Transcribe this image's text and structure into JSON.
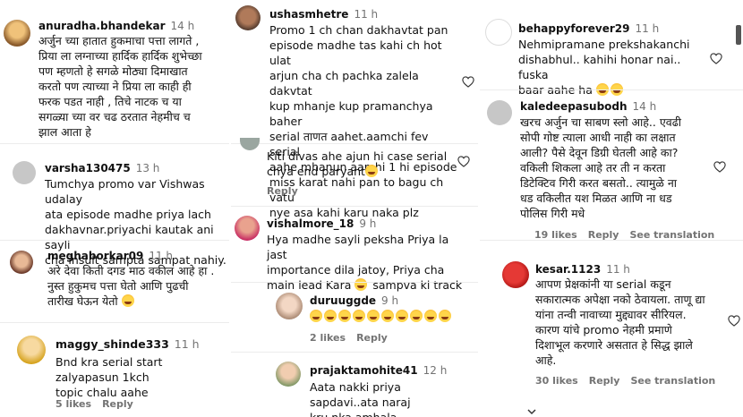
{
  "col1": {
    "c1": {
      "user": "anuradha.bhandekar",
      "time": "14 h",
      "lines": [
        "अर्जुन च्या हातात हुकमाचा पत्ता लागते ,",
        "प्रिया ला लग्नाच्या हार्दिक हार्दिक शुभेच्छा",
        "पण म्हणतो हे सगळे मोठ्या दिमाखात",
        "करतो पण त्याच्या ने प्रिया ला काही ही",
        "फरक पडत नाही , तिचे नाटक च या",
        "सगळ्या च्या वर चढ ठरतात नेहमीच च",
        "झाल आता हे"
      ]
    },
    "c2": {
      "user": "varsha130475",
      "time": "13 h",
      "lines": [
        "Tumchya promo var Vishwas udalay",
        "ata episode madhe priya lach",
        "dakhavnar.priyachi kautak ani sayli",
        "cha insult sampta sampat nahiy."
      ]
    },
    "c3": {
      "user": "meghaborkar09",
      "time": "11 h",
      "lines": [
        "अरे देवा किती दगड माठ वकील आहे हा .",
        "नुस्त हुकुमच पत्ता घेतो आणि पुढची",
        "तारीख घेऊन येतो"
      ]
    },
    "c4": {
      "user": "maggy_shinde333",
      "time": "11 h",
      "lines": [
        "Bnd kra serial start zalyapasun 1kch",
        "topic chalu aahe"
      ],
      "likes": "5 likes",
      "reply": "Reply"
    }
  },
  "col2": {
    "c1": {
      "user": "ushasmhetre",
      "time": "11 h",
      "lines": [
        "Promo 1 ch chan dakhavtat pan",
        "episode madhe tas kahi ch hot ulat",
        "arjun cha ch pachka zalela dakvtat",
        "kup mhanje kup pramanchya baher",
        "serial ताणत aahet.aamchi fev serial",
        "aahe mhanun aamhi 1 hi episode",
        "miss karat nahi pan to bagu ch vatu",
        "nye asa kahi karu naka plz"
      ]
    },
    "c2": {
      "lines": [
        "Kiti divas ahe ajun hi case serial",
        "chya end paryant"
      ],
      "reply": "Reply"
    },
    "c3": {
      "user": "vishalmore_18",
      "time": "9 h",
      "lines": [
        "Hya madhe sayli peksha Priya la jast",
        "importance dila jatoy, Priya cha",
        "main lead Kara",
        "sampva ki track"
      ]
    },
    "c4": {
      "user": "duruuggde",
      "time": "9 h",
      "likes": "2 likes",
      "reply": "Reply"
    },
    "c5": {
      "user": "prajaktamohite41",
      "time": "12 h",
      "lines": [
        "Aata nakki priya sapdavi..ata naraj",
        "kru nka amhala"
      ]
    }
  },
  "col3": {
    "c1": {
      "user": "behappyforever29",
      "time": "11 h",
      "lines": [
        "Nehmipramane prekshakanchi",
        "dishabhul.. kahihi honar nai.. fuska",
        "baar aahe ha"
      ]
    },
    "c2": {
      "user": "kaledeepasubodh",
      "time": "14 h",
      "lines": [
        "खरच अर्जुन चा साबण स्लो आहे.. एवढी",
        "सोपी गोष्ट त्याला आधी नाही का लक्षात",
        "आली? पैसे देवून डिग्री घेतली आहे का?",
        "वकिली शिकला आहे तर ती न करता",
        "डिटेक्टिव गिरी करत बसतो.. त्यामुळे ना",
        "धड वकिलीत यश मिळत आणि ना धड",
        "पोलिस गिरी मधे"
      ],
      "likes": "19 likes",
      "reply": "Reply",
      "see": "See translation"
    },
    "c3": {
      "user": "kesar.1123",
      "time": "11 h",
      "lines": [
        "आपण प्रेक्षकांनी या serial कडून",
        "सकारात्मक अपेक्षा नको ठेवायला. ताणू द्या",
        "यांना तन्वी नावाच्या मुद्द्यावर सीरियल.",
        "कारण यांचे promo नेहमी प्रमाणे",
        "दिशाभूल करणारे असतात हे सिद्ध झाले",
        "आहे."
      ],
      "likes": "30 likes",
      "reply": "Reply",
      "see": "See translation"
    }
  }
}
